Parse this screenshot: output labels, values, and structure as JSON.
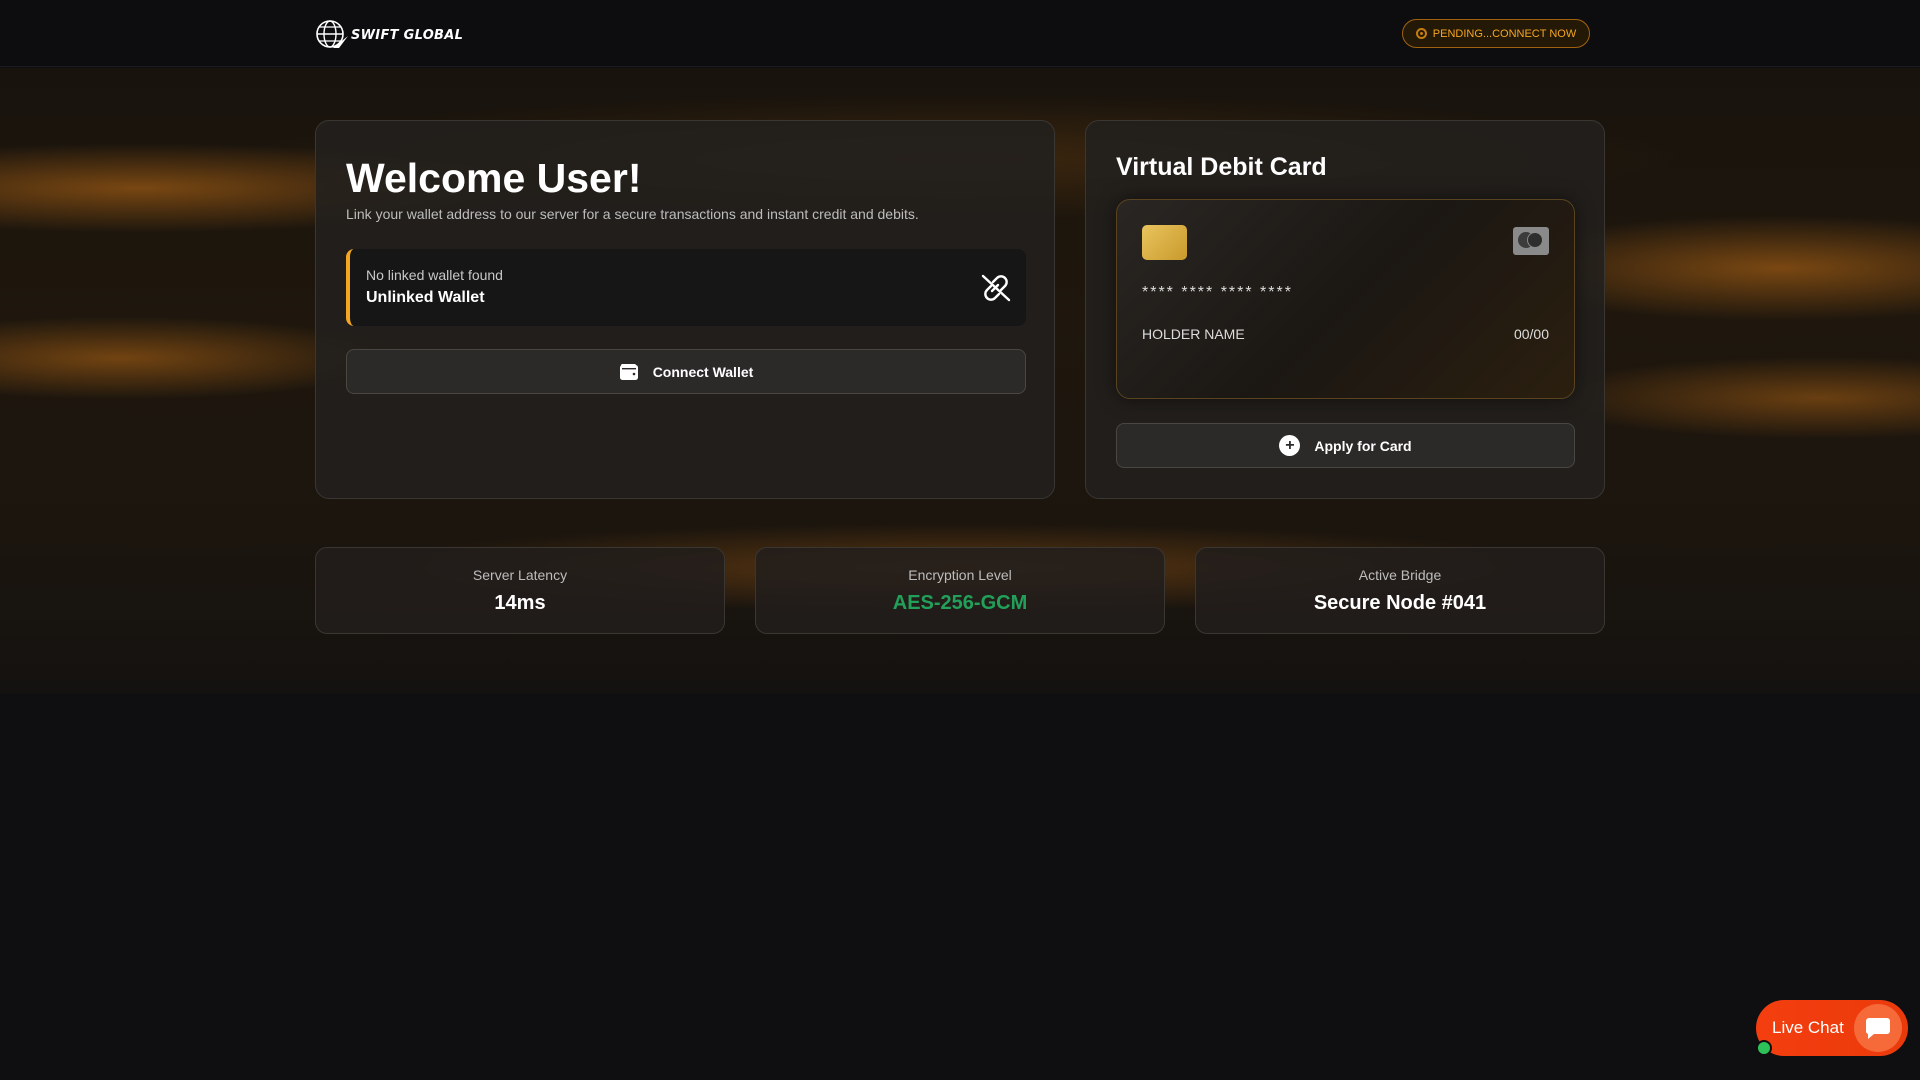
{
  "header": {
    "brand": "SWIFT GLOBAL",
    "status_label": "PENDING...CONNECT NOW",
    "status_color": "#f5a623"
  },
  "welcome": {
    "title": "Welcome User!",
    "subtitle": "Link your wallet address to our server for a secure transactions and instant credit and debits.",
    "wallet_status_small": "No linked wallet found",
    "wallet_status_main": "Unlinked Wallet",
    "wallet_status_icon": "unlink-icon",
    "connect_button": "Connect Wallet",
    "connect_button_icon": "wallet-icon"
  },
  "card": {
    "title": "Virtual Debit Card",
    "number": "**** **** **** ****",
    "holder": "HOLDER NAME",
    "expiry": "00/00",
    "brand_icon": "mastercard-icon",
    "apply_button": "Apply for Card",
    "apply_button_icon": "plus-circle-icon"
  },
  "stats": [
    {
      "label": "Server Latency",
      "value": "14ms"
    },
    {
      "label": "Encryption Level",
      "value": "AES-256-GCM",
      "color": "#22a05a"
    },
    {
      "label": "Active Bridge",
      "value": "Secure Node #041"
    }
  ],
  "live_chat": {
    "label": "Live Chat",
    "icon": "chat-bubble-icon",
    "accent": "#f43e0f",
    "online_color": "#2ec15a"
  }
}
